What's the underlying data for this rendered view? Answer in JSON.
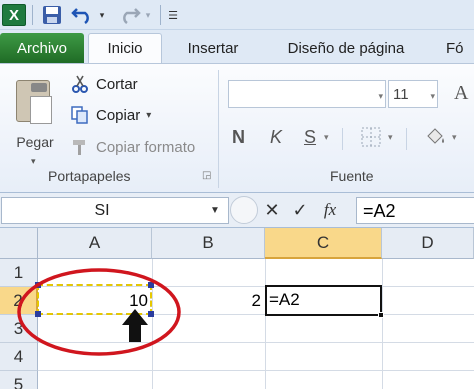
{
  "ribbon_tabs": {
    "file": "Archivo",
    "home": "Inicio",
    "insert": "Insertar",
    "page_layout": "Diseño de página",
    "formulas": "Fó"
  },
  "clipboard_group": {
    "paste": "Pegar",
    "cut": "Cortar",
    "copy": "Copiar",
    "copy_arrow": "▾",
    "format_painter": "Copiar formato",
    "label": "Portapapeles"
  },
  "font_group": {
    "font_name": "",
    "font_size": "11",
    "bold": "N",
    "italic": "K",
    "underline": "S",
    "label": "Fuente"
  },
  "formula_bar": {
    "name_box": "SI",
    "cancel": "✕",
    "enter": "✓",
    "insert_function": "fx",
    "formula": "=A2"
  },
  "sheet": {
    "columns": [
      "A",
      "B",
      "C",
      "D"
    ],
    "rows": [
      "1",
      "2",
      "3",
      "4",
      "5"
    ],
    "cells": {
      "A2": "10",
      "B2": "2",
      "C2": "=A2"
    }
  },
  "colors": {
    "file_tab": "#2d7b33",
    "copy_marquee": "#2b3d9e",
    "annotation": "#d0161e",
    "active_header": "#f9d88a"
  }
}
